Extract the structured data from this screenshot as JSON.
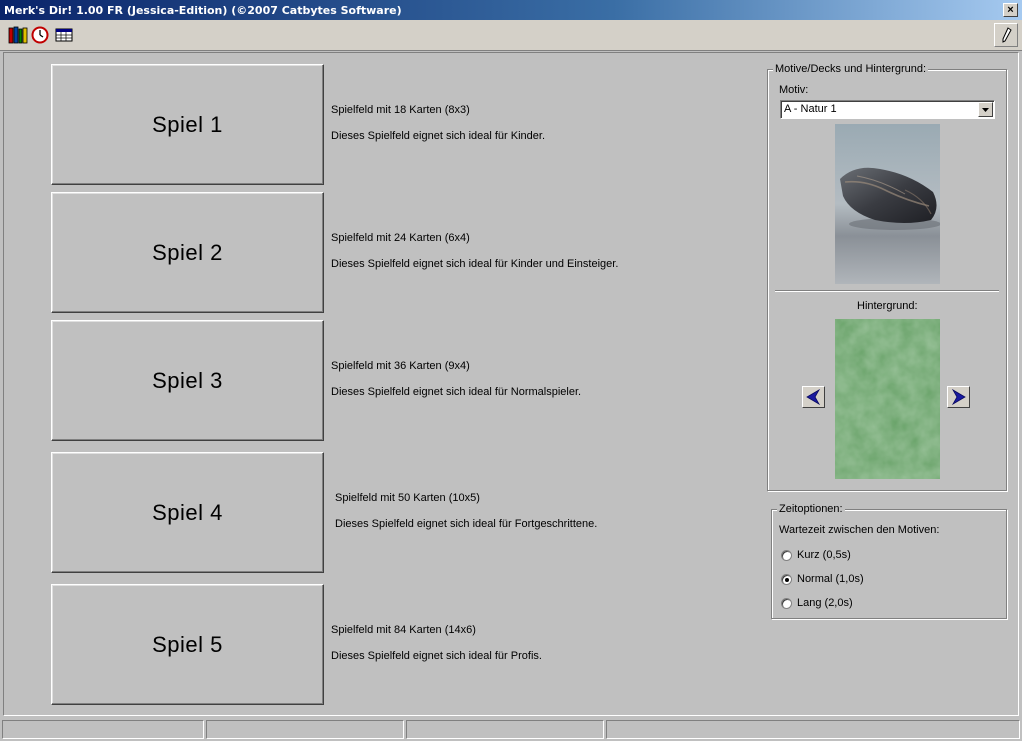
{
  "window": {
    "title": "Merk's Dir! 1.00 FR (Jessica-Edition) (©2007 Catbytes Software)",
    "close_glyph": "×"
  },
  "toolbar": {
    "icons": [
      "books-icon",
      "clock-icon",
      "table-icon"
    ],
    "help_icon": "pen-icon"
  },
  "games": [
    {
      "label": "Spiel 1",
      "line1": "Spielfeld mit 18 Karten (8x3)",
      "line2": "Dieses Spielfeld eignet sich ideal für Kinder."
    },
    {
      "label": "Spiel 2",
      "line1": "Spielfeld mit 24 Karten (6x4)",
      "line2": "Dieses Spielfeld eignet sich ideal für Kinder und Einsteiger."
    },
    {
      "label": "Spiel 3",
      "line1": "Spielfeld mit 36 Karten (9x4)",
      "line2": "Dieses Spielfeld eignet sich ideal für Normalspieler."
    },
    {
      "label": "Spiel 4",
      "line1": "Spielfeld mit 50 Karten (10x5)",
      "line2": "Dieses Spielfeld eignet sich ideal für Fortgeschrittene."
    },
    {
      "label": "Spiel 5",
      "line1": "Spielfeld mit 84 Karten (14x6)",
      "line2": "Dieses Spielfeld eignet sich ideal für Profis."
    }
  ],
  "motive": {
    "group_label": "Motive/Decks und Hintergrund:",
    "motiv_label": "Motiv:",
    "motiv_selected": "A - Natur 1",
    "hintergrund_label": "Hintergrund:"
  },
  "zeit": {
    "group_label": "Zeitoptionen:",
    "wait_label": "Wartezeit zwischen den Motiven:",
    "options": [
      {
        "label": "Kurz (0,5s)",
        "checked": false
      },
      {
        "label": "Normal (1,0s)",
        "checked": true
      },
      {
        "label": "Lang (2,0s)",
        "checked": false
      }
    ]
  },
  "colors": {
    "face": "#c0c0c0",
    "title_start": "#0a246a",
    "arrow": "#1a1aa0",
    "felt": "#6aa46a"
  }
}
